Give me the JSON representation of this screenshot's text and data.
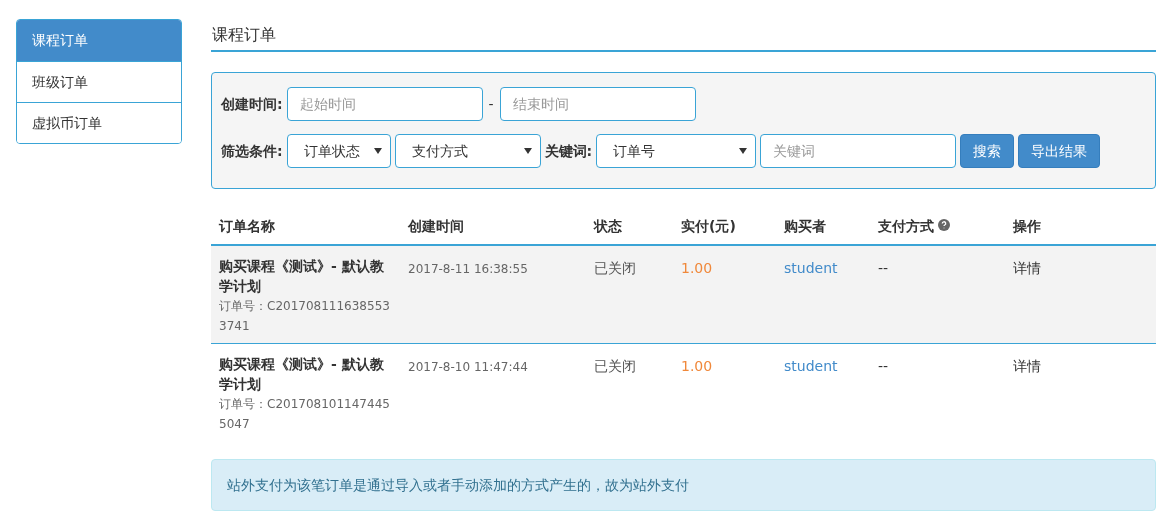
{
  "sidebar": {
    "items": [
      {
        "label": "课程订单",
        "selected": true
      },
      {
        "label": "班级订单",
        "selected": false
      },
      {
        "label": "虚拟币订单",
        "selected": false
      }
    ]
  },
  "title": "课程订单",
  "filters": {
    "date_label": "创建时间:",
    "start_placeholder": "起始时间",
    "separator": "-",
    "end_placeholder": "结束时间",
    "condition_label": "筛选条件:",
    "status_select": "订单状态",
    "payment_select": "支付方式",
    "keyword_label": "关键词:",
    "keyword_type_select": "订单号",
    "keyword_placeholder": "关键词",
    "search_button": "搜索",
    "export_button": "导出结果"
  },
  "table": {
    "columns": [
      "订单名称",
      "创建时间",
      "状态",
      "实付(元)",
      "购买者",
      "支付方式",
      "操作"
    ],
    "rows": [
      {
        "name": "购买课程《测试》- 默认教学计划",
        "order_no": "订单号：C2017081116385533741",
        "created": "2017-8-11 16:38:55",
        "status": "已关闭",
        "paid": "1.00",
        "buyer": "student",
        "payment": "--",
        "action": "详情",
        "highlighted": true
      },
      {
        "name": "购买课程《测试》- 默认教学计划",
        "order_no": "订单号：C2017081011474455047",
        "created": "2017-8-10 11:47:44",
        "status": "已关闭",
        "paid": "1.00",
        "buyer": "student",
        "payment": "--",
        "action": "详情",
        "highlighted": false
      }
    ]
  },
  "notice": "站外支付为该笔订单是通过导入或者手动添加的方式产生的，故为站外支付"
}
